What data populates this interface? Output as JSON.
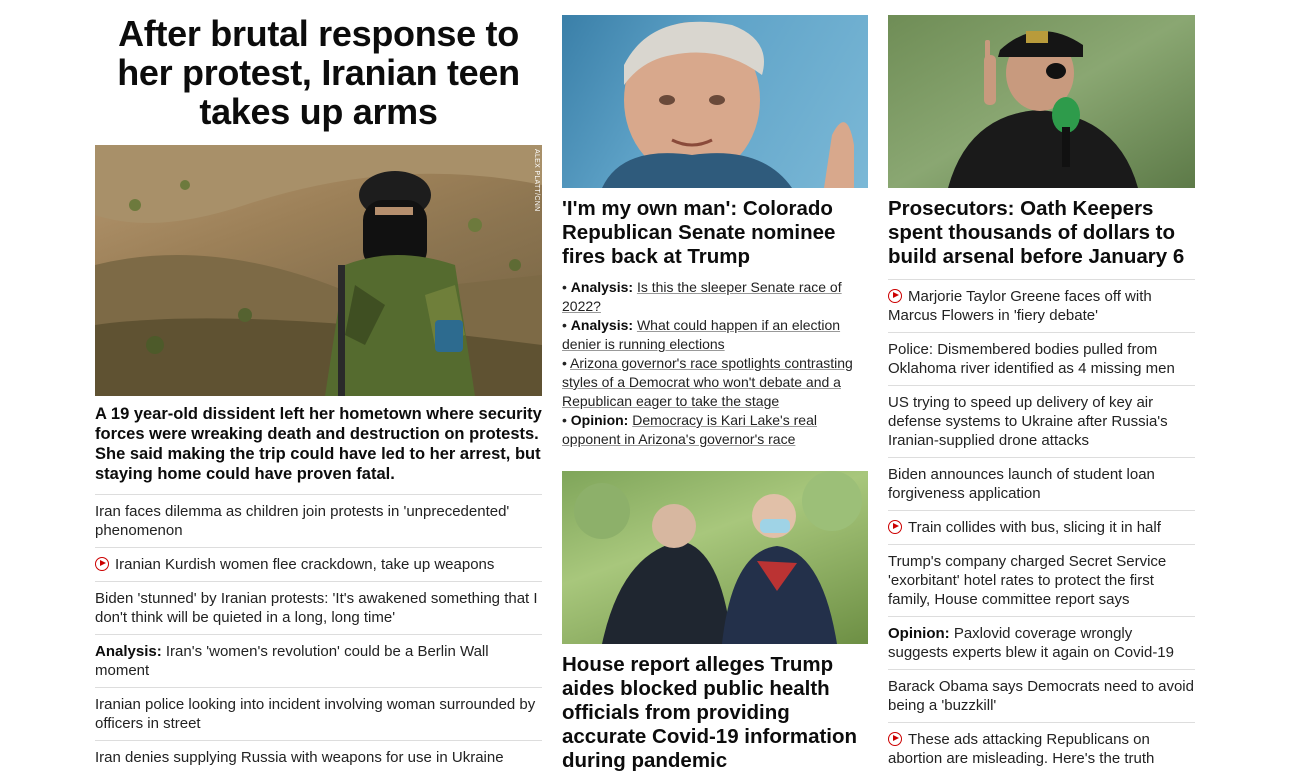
{
  "lead": {
    "headline": "After brutal response to her protest, Iranian teen takes up arms",
    "photo_credit": "ALEX PLATT/CNN",
    "summary": "A 19 year-old dissident left her hometown where security forces were wreaking death and destruction on protests. She said making the trip could have led to her arrest, but staying home could have proven fatal.",
    "related": [
      {
        "prefix": "",
        "text": "Iran faces dilemma as children join protests in 'unprecedented' phenomenon",
        "video": false
      },
      {
        "prefix": "",
        "text": "Iranian Kurdish women flee crackdown, take up weapons",
        "video": true
      },
      {
        "prefix": "",
        "text": "Biden 'stunned' by Iranian protests: 'It's awakened something that I don't think will be quieted in a long, long time'",
        "video": false
      },
      {
        "prefix": "Analysis:",
        "text": " Iran's 'women's revolution' could be a Berlin Wall moment",
        "video": false
      },
      {
        "prefix": "",
        "text": "Iranian police looking into incident involving woman surrounded by officers in street",
        "video": false
      },
      {
        "prefix": "",
        "text": "Iran denies supplying Russia with weapons for use in Ukraine",
        "video": false
      }
    ]
  },
  "colorado": {
    "headline": "'I'm my own man': Colorado Republican Senate nominee fires back at Trump",
    "bullets": [
      {
        "prefix": "Analysis:",
        "text": "Is this the sleeper Senate race of 2022?"
      },
      {
        "prefix": "Analysis:",
        "text": "What could happen if an election denier is running elections"
      },
      {
        "prefix": "",
        "text": "Arizona governor's race spotlights contrasting styles of a Democrat who won't debate and a Republican eager to take the stage"
      },
      {
        "prefix": "Opinion:",
        "text": "Democracy is Kari Lake's real opponent in Arizona's governor's race"
      }
    ]
  },
  "house_report": {
    "headline": "House report alleges Trump aides blocked public health officials from providing accurate Covid-19 information during pandemic"
  },
  "oath": {
    "headline": "Prosecutors: Oath Keepers spent thousands of dollars to build arsenal before January 6",
    "related": [
      {
        "prefix": "",
        "text": "Marjorie Taylor Greene faces off with Marcus Flowers in 'fiery debate'",
        "video": true
      },
      {
        "prefix": "",
        "text": "Police: Dismembered bodies pulled from Oklahoma river identified as 4 missing men",
        "video": false
      },
      {
        "prefix": "",
        "text": "US trying to speed up delivery of key air defense systems to Ukraine after Russia's Iranian-supplied drone attacks",
        "video": false
      },
      {
        "prefix": "",
        "text": "Biden announces launch of student loan forgiveness application",
        "video": false
      },
      {
        "prefix": "",
        "text": "Train collides with bus, slicing it in half",
        "video": true
      },
      {
        "prefix": "",
        "text": "Trump's company charged Secret Service 'exorbitant' hotel rates to protect the first family, House committee report says",
        "video": false
      },
      {
        "prefix": "Opinion:",
        "text": " Paxlovid coverage wrongly suggests experts blew it again on Covid-19",
        "video": false
      },
      {
        "prefix": "",
        "text": "Barack Obama says Democrats need to avoid being a 'buzzkill'",
        "video": false
      },
      {
        "prefix": "",
        "text": "These ads attacking Republicans on abortion are misleading. Here's the truth",
        "video": true
      }
    ]
  }
}
